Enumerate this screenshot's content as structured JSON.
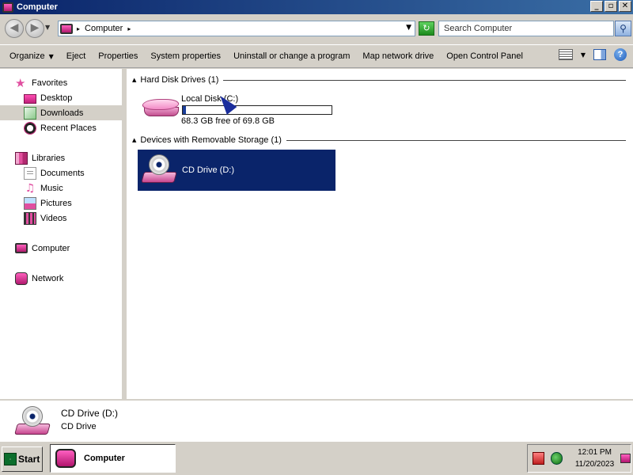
{
  "window": {
    "title": "Computer",
    "buttons": {
      "minimize": "_",
      "maximize": "▫",
      "close": "✕"
    }
  },
  "address": {
    "crumb": "Computer",
    "search_placeholder": "Search Computer"
  },
  "toolbar": {
    "items": [
      "Organize",
      "Eject",
      "Properties",
      "System properties",
      "Uninstall or change a program",
      "Map network drive",
      "Open Control Panel"
    ]
  },
  "nav": {
    "favorites": {
      "label": "Favorites",
      "items": [
        "Desktop",
        "Downloads",
        "Recent Places"
      ]
    },
    "libraries": {
      "label": "Libraries",
      "items": [
        "Documents",
        "Music",
        "Pictures",
        "Videos"
      ]
    },
    "computer": "Computer",
    "network": "Network",
    "selected": "Downloads"
  },
  "content": {
    "groups": [
      {
        "header": "Hard Disk Drives (1)",
        "drive_name": "Local Disk (C:)",
        "free_text": "68.3 GB free of 69.8 GB",
        "used_fraction": 0.021
      },
      {
        "header": "Devices with Removable Storage (1)",
        "drive_name": "CD Drive (D:)"
      }
    ]
  },
  "details": {
    "name": "CD Drive (D:)",
    "type": "CD Drive"
  },
  "taskbar": {
    "start": "Start",
    "task": "Computer",
    "time": "12:01 PM",
    "date": "11/20/2023"
  }
}
